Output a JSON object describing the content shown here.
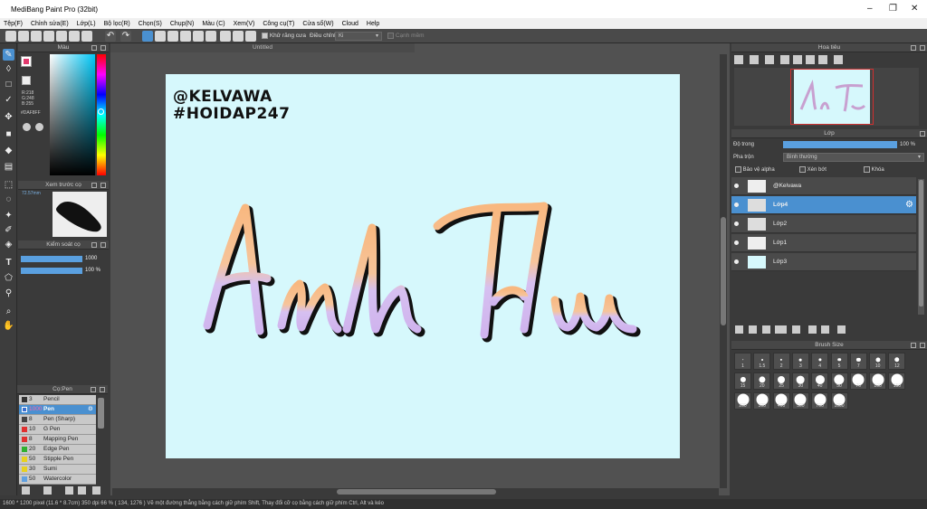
{
  "window": {
    "title": "MediBang Paint Pro (32bit)"
  },
  "menu": [
    "Tệp(F)",
    "Chỉnh sửa(E)",
    "Lớp(L)",
    "Bộ lọc(R)",
    "Chọn(S)",
    "Chụp(N)",
    "Màu (C)",
    "Xem(V)",
    "Công cụ(T)",
    "Cửa sổ(W)",
    "Cloud",
    "Help"
  ],
  "toolbar": {
    "antialias": "Khử răng cưa",
    "adjust": "Điều chỉnh",
    "adjust_value": "Ki",
    "snap": "Cạnh mềm"
  },
  "color_panel": {
    "title": "Màu",
    "r": "R:218",
    "g": "G:248",
    "b": "B:255",
    "hex": "#DAF8FF",
    "accent": "#e23a6e"
  },
  "brush_preview": {
    "title": "Xem trước cọ",
    "size": "72.57mm"
  },
  "brush_control": {
    "title": "Kiểm soát cọ",
    "size": "1000",
    "opacity": "100 %"
  },
  "brush_list": {
    "title": "Cọ:Pen",
    "items": [
      {
        "size": "3",
        "name": "Pencil",
        "color": "#333333"
      },
      {
        "size": "1000",
        "name": "Pen",
        "color": "#3a6fd0"
      },
      {
        "size": "8",
        "name": "Pen (Sharp)",
        "color": "#444444"
      },
      {
        "size": "10",
        "name": "G Pen",
        "color": "#e03030"
      },
      {
        "size": "8",
        "name": "Mapping Pen",
        "color": "#e03030"
      },
      {
        "size": "20",
        "name": "Edge Pen",
        "color": "#30b030"
      },
      {
        "size": "50",
        "name": "Stipple Pen",
        "color": "#e8d020"
      },
      {
        "size": "30",
        "name": "Sumi",
        "color": "#e8d020"
      },
      {
        "size": "50",
        "name": "Watercolor",
        "color": "#60a0e0"
      }
    ]
  },
  "document": {
    "title": "Untitled",
    "line1": "@KELVAWA",
    "line2": "#HOIDAP247",
    "script_text": "Anh Thu"
  },
  "navigator": {
    "title": "Hoa tiêu"
  },
  "layer_panel": {
    "title": "Lớp",
    "opacity_label": "Độ trong",
    "opacity_value": "100 %",
    "opacity_fraction": 1.0,
    "blend_label": "Pha trộn",
    "blend_value": "Bình thường",
    "protect_alpha": "Bảo vệ alpha",
    "clip": "Xén bớt",
    "lock": "Khóa",
    "layers": [
      {
        "name": "@Kelvawa"
      },
      {
        "name": "Lớp4"
      },
      {
        "name": "Lớp2"
      },
      {
        "name": "Lớp1"
      },
      {
        "name": "Lớp3"
      }
    ]
  },
  "brush_size": {
    "title": "Brush Size",
    "sizes": [
      "1",
      "1.5",
      "2",
      "3",
      "4",
      "5",
      "7",
      "10",
      "12",
      "15",
      "20",
      "25",
      "30",
      "40",
      "50",
      "70",
      "100",
      "150",
      "200",
      "300",
      "400",
      "500",
      "700",
      "1000"
    ]
  },
  "status": "1600 * 1200 pixel   (11.6 * 8.7cm)   350 dpi   66 %   ( 134, 1276 )   Vẽ một đường thẳng bằng cách giữ phím Shift, Thay đổi cỡ cọ bằng cách giữ phím Ctrl, Alt và kéo"
}
